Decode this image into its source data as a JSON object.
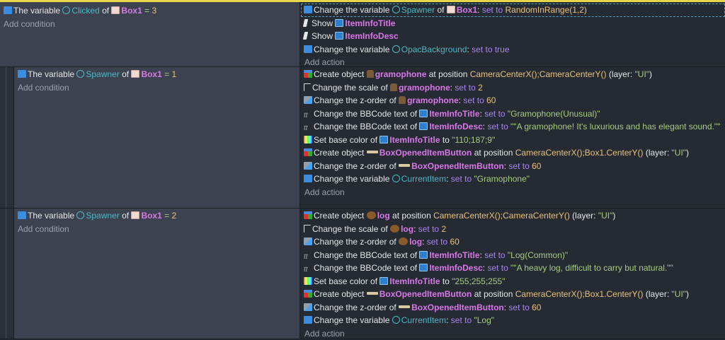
{
  "add_condition": "Add condition",
  "add_action": "Add action",
  "events": [
    {
      "conditions": [
        {
          "icon": "var",
          "parts": [
            {
              "c": "t",
              "x": "The variable "
            },
            {
              "c": "v",
              "x": "Clicked",
              "i": "varico"
            },
            {
              "c": "t",
              "x": " of "
            },
            {
              "c": "o",
              "x": "Box1",
              "i": "box"
            },
            {
              "c": "s",
              "x": "  =  "
            },
            {
              "c": "n",
              "x": "3"
            }
          ]
        }
      ],
      "actions": [
        {
          "icon": "var",
          "selected": true,
          "parts": [
            {
              "c": "t",
              "x": "Change the variable "
            },
            {
              "c": "v",
              "x": "Spawner",
              "i": "varico"
            },
            {
              "c": "t",
              "x": " of "
            },
            {
              "c": "o",
              "x": "Box1",
              "i": "box"
            },
            {
              "c": "t",
              "x": ": "
            },
            {
              "c": "k",
              "x": "set to "
            },
            {
              "c": "e",
              "x": "RandomInRange(1,2)"
            }
          ]
        },
        {
          "icon": "show",
          "parts": [
            {
              "c": "t",
              "x": "Show "
            },
            {
              "c": "o",
              "x": "ItemInfoTitle",
              "i": "text"
            }
          ]
        },
        {
          "icon": "show",
          "parts": [
            {
              "c": "t",
              "x": "Show "
            },
            {
              "c": "o",
              "x": "ItemInfoDesc",
              "i": "text"
            }
          ]
        },
        {
          "icon": "var",
          "parts": [
            {
              "c": "t",
              "x": "Change the variable "
            },
            {
              "c": "v",
              "x": "OpacBackground",
              "i": "glob"
            },
            {
              "c": "t",
              "x": ": "
            },
            {
              "c": "k",
              "x": "set to true"
            }
          ]
        }
      ]
    },
    {
      "conditions": [
        {
          "icon": "var",
          "parts": [
            {
              "c": "t",
              "x": "The variable "
            },
            {
              "c": "v",
              "x": "Spawner",
              "i": "varico"
            },
            {
              "c": "t",
              "x": " of "
            },
            {
              "c": "o",
              "x": "Box1",
              "i": "box"
            },
            {
              "c": "s",
              "x": "  =  "
            },
            {
              "c": "n",
              "x": "1"
            }
          ]
        }
      ],
      "actions": [
        {
          "icon": "create",
          "parts": [
            {
              "c": "t",
              "x": "Create object "
            },
            {
              "c": "o",
              "x": "gramophone",
              "i": "gram"
            },
            {
              "c": "t",
              "x": " at position "
            },
            {
              "c": "e",
              "x": "CameraCenterX();CameraCenterY()"
            },
            {
              "c": "t",
              "x": " (layer: "
            },
            {
              "c": "s",
              "x": "\"UI\""
            },
            {
              "c": "t",
              "x": ")"
            }
          ]
        },
        {
          "icon": "scale",
          "parts": [
            {
              "c": "t",
              "x": "Change the scale of "
            },
            {
              "c": "o",
              "x": "gramophone",
              "i": "gram"
            },
            {
              "c": "t",
              "x": ": "
            },
            {
              "c": "k",
              "x": "set to "
            },
            {
              "c": "n",
              "x": "2"
            }
          ]
        },
        {
          "icon": "zorder",
          "parts": [
            {
              "c": "t",
              "x": "Change the z-order of "
            },
            {
              "c": "o",
              "x": "gramophone",
              "i": "gram"
            },
            {
              "c": "t",
              "x": ": "
            },
            {
              "c": "k",
              "x": "set to "
            },
            {
              "c": "n",
              "x": "60"
            }
          ]
        },
        {
          "icon": "bbcode",
          "parts": [
            {
              "c": "t",
              "x": "Change the BBCode text of "
            },
            {
              "c": "o",
              "x": "ItemInfoTitle",
              "i": "text"
            },
            {
              "c": "t",
              "x": ": "
            },
            {
              "c": "k",
              "x": "set to "
            },
            {
              "c": "s",
              "x": "\"Gramophone(Unusual)\""
            }
          ]
        },
        {
          "icon": "bbcode",
          "parts": [
            {
              "c": "t",
              "x": "Change the BBCode text of "
            },
            {
              "c": "o",
              "x": "ItemInfoDesc",
              "i": "text"
            },
            {
              "c": "t",
              "x": ": "
            },
            {
              "c": "k",
              "x": "set to "
            },
            {
              "c": "s",
              "x": "\"\"A gramophone! It's luxurious and has elegant sound.\"\""
            }
          ]
        },
        {
          "icon": "color",
          "parts": [
            {
              "c": "t",
              "x": "Set base color of "
            },
            {
              "c": "o",
              "x": "ItemInfoTitle",
              "i": "text"
            },
            {
              "c": "t",
              "x": " to "
            },
            {
              "c": "s",
              "x": "\"110;187;9\""
            }
          ]
        },
        {
          "icon": "create",
          "parts": [
            {
              "c": "t",
              "x": "Create object "
            },
            {
              "c": "o",
              "x": "BoxOpenedItemButton",
              "i": "btn"
            },
            {
              "c": "t",
              "x": " at position "
            },
            {
              "c": "e",
              "x": "CameraCenterX();Box1.CenterY()"
            },
            {
              "c": "t",
              "x": " (layer: "
            },
            {
              "c": "s",
              "x": "\"UI\""
            },
            {
              "c": "t",
              "x": ")"
            }
          ]
        },
        {
          "icon": "zorder",
          "parts": [
            {
              "c": "t",
              "x": "Change the z-order of "
            },
            {
              "c": "o",
              "x": "BoxOpenedItemButton",
              "i": "btn"
            },
            {
              "c": "t",
              "x": ": "
            },
            {
              "c": "k",
              "x": "set to "
            },
            {
              "c": "n",
              "x": "60"
            }
          ]
        },
        {
          "icon": "var",
          "parts": [
            {
              "c": "t",
              "x": "Change the variable "
            },
            {
              "c": "v",
              "x": "CurrentItem",
              "i": "glob"
            },
            {
              "c": "t",
              "x": ": "
            },
            {
              "c": "k",
              "x": "set to "
            },
            {
              "c": "s",
              "x": "\"Gramophone\""
            }
          ]
        }
      ]
    },
    {
      "conditions": [
        {
          "icon": "var",
          "parts": [
            {
              "c": "t",
              "x": "The variable "
            },
            {
              "c": "v",
              "x": "Spawner",
              "i": "varico"
            },
            {
              "c": "t",
              "x": " of "
            },
            {
              "c": "o",
              "x": "Box1",
              "i": "box"
            },
            {
              "c": "s",
              "x": "  =  "
            },
            {
              "c": "n",
              "x": "2"
            }
          ]
        }
      ],
      "actions": [
        {
          "icon": "create",
          "parts": [
            {
              "c": "t",
              "x": "Create object "
            },
            {
              "c": "o",
              "x": "log",
              "i": "log"
            },
            {
              "c": "t",
              "x": " at position "
            },
            {
              "c": "e",
              "x": "CameraCenterX();CameraCenterY()"
            },
            {
              "c": "t",
              "x": " (layer: "
            },
            {
              "c": "s",
              "x": "\"UI\""
            },
            {
              "c": "t",
              "x": ")"
            }
          ]
        },
        {
          "icon": "scale",
          "parts": [
            {
              "c": "t",
              "x": "Change the scale of "
            },
            {
              "c": "o",
              "x": "log",
              "i": "log"
            },
            {
              "c": "t",
              "x": ": "
            },
            {
              "c": "k",
              "x": "set to "
            },
            {
              "c": "n",
              "x": "2"
            }
          ]
        },
        {
          "icon": "zorder",
          "parts": [
            {
              "c": "t",
              "x": "Change the z-order of "
            },
            {
              "c": "o",
              "x": "log",
              "i": "log"
            },
            {
              "c": "t",
              "x": ": "
            },
            {
              "c": "k",
              "x": "set to "
            },
            {
              "c": "n",
              "x": "60"
            }
          ]
        },
        {
          "icon": "bbcode",
          "parts": [
            {
              "c": "t",
              "x": "Change the BBCode text of "
            },
            {
              "c": "o",
              "x": "ItemInfoTitle",
              "i": "text"
            },
            {
              "c": "t",
              "x": ": "
            },
            {
              "c": "k",
              "x": "set to "
            },
            {
              "c": "s",
              "x": "\"Log(Common)\""
            }
          ]
        },
        {
          "icon": "bbcode",
          "parts": [
            {
              "c": "t",
              "x": "Change the BBCode text of "
            },
            {
              "c": "o",
              "x": "ItemInfoDesc",
              "i": "text"
            },
            {
              "c": "t",
              "x": ": "
            },
            {
              "c": "k",
              "x": "set to "
            },
            {
              "c": "s",
              "x": "\"\"A heavy log, difficult to carry but natural.\"\""
            }
          ]
        },
        {
          "icon": "color",
          "parts": [
            {
              "c": "t",
              "x": "Set base color of "
            },
            {
              "c": "o",
              "x": "ItemInfoTitle",
              "i": "text"
            },
            {
              "c": "t",
              "x": " to "
            },
            {
              "c": "s",
              "x": "\"255;255;255\""
            }
          ]
        },
        {
          "icon": "create",
          "parts": [
            {
              "c": "t",
              "x": "Create object "
            },
            {
              "c": "o",
              "x": "BoxOpenedItemButton",
              "i": "btn"
            },
            {
              "c": "t",
              "x": " at position "
            },
            {
              "c": "e",
              "x": "CameraCenterX();Box1.CenterY()"
            },
            {
              "c": "t",
              "x": " (layer: "
            },
            {
              "c": "s",
              "x": "\"UI\""
            },
            {
              "c": "t",
              "x": ")"
            }
          ]
        },
        {
          "icon": "zorder",
          "parts": [
            {
              "c": "t",
              "x": "Change the z-order of "
            },
            {
              "c": "o",
              "x": "BoxOpenedItemButton",
              "i": "btn"
            },
            {
              "c": "t",
              "x": ": "
            },
            {
              "c": "k",
              "x": "set to "
            },
            {
              "c": "n",
              "x": "60"
            }
          ]
        },
        {
          "icon": "var",
          "parts": [
            {
              "c": "t",
              "x": "Change the variable "
            },
            {
              "c": "v",
              "x": "CurrentItem",
              "i": "glob"
            },
            {
              "c": "t",
              "x": ": "
            },
            {
              "c": "k",
              "x": "set to "
            },
            {
              "c": "s",
              "x": "\"Log\""
            }
          ]
        }
      ]
    }
  ]
}
